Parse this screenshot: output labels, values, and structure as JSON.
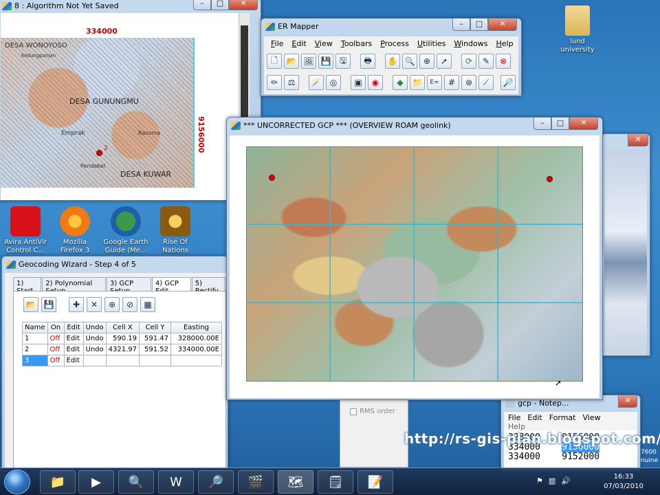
{
  "desktop": {
    "folder_label": "lund university",
    "icons": [
      {
        "label": "Avira AntiVir Control C...",
        "color": "#d8121a"
      },
      {
        "label": "Mozilla Firefox 3",
        "color": "#f07a16"
      },
      {
        "label": "Google Earth Guide (Me...",
        "color": "#2a8a3a"
      },
      {
        "label": "Rise Of Nations",
        "color": "#b8860b"
      }
    ],
    "watermark": "http://rs-gis-plan.blogspot.com/"
  },
  "algorithm_window": {
    "title": "8 : Algorithm Not Yet Saved",
    "easting_label": "334000",
    "northing_label": "9156000",
    "place_labels": [
      "DESA WONOYOSO",
      "DESA GUNUNGMU",
      "DESA KUWAR",
      "Emprak",
      "Rasoma",
      "Pendekel",
      "Kedungpanjan"
    ],
    "gcp_marker": "2"
  },
  "er_mapper": {
    "title": "ER Mapper",
    "menu": [
      "File",
      "Edit",
      "View",
      "Toolbars",
      "Process",
      "Utilities",
      "Windows",
      "Help"
    ],
    "toolbar1": [
      "new-file-icon",
      "open-folder-icon",
      "open-image-icon",
      "save-icon",
      "save-as-icon",
      "print-icon",
      "hand-icon",
      "zoom-icon",
      "zoom-box-icon",
      "pointer-icon",
      "refresh-icon",
      "edit-icon",
      "stop-icon"
    ],
    "toolbar2": [
      "pencil-icon",
      "balance-icon",
      "wizard-icon",
      "gps-icon",
      "image-process-icon",
      "filter-icon",
      "layers-icon",
      "folder-icon",
      "formula-icon",
      "grid-icon",
      "target-icon",
      "chart-icon",
      "search-icon"
    ]
  },
  "overview_window": {
    "title": "*** UNCORRECTED GCP *** (OVERVIEW ROAM geolink)"
  },
  "geocoding": {
    "title": "Geocoding Wizard - Step 4 of 5",
    "tabs": [
      "1) Start",
      "2) Polynomial Setup",
      "3) GCP Setup",
      "4) GCP Edit",
      "5) Rectify"
    ],
    "active_tab": 3,
    "columns": [
      "Name",
      "On",
      "Edit",
      "Undo",
      "Cell X",
      "Cell Y",
      "Easting"
    ],
    "rows": [
      [
        "1",
        "Off",
        "Edit",
        "Undo",
        "590.19",
        "591.47",
        "328000.00E"
      ],
      [
        "2",
        "Off",
        "Edit",
        "Undo",
        "4321.97",
        "591.52",
        "334000.00E"
      ],
      [
        "3",
        "Off",
        "Edit",
        "",
        "",
        "",
        ""
      ]
    ],
    "rms_order_label": "RMS order"
  },
  "notepad": {
    "title": "gcp - Notep...",
    "menu": [
      "File",
      "Edit",
      "Format",
      "View"
    ],
    "help_label": "Help",
    "lines": [
      {
        "easting": "328000",
        "northing": "9156000"
      },
      {
        "easting": "334000",
        "northing": "9156000"
      },
      {
        "easting": "334000",
        "northing": "9152000"
      }
    ]
  },
  "side_strip": {
    "text": "7600",
    "text2": "nuine"
  },
  "taskbar": {
    "start_icon": "windows-start-icon",
    "clock_time": "16:33",
    "clock_date": "07/03/2010"
  },
  "colors": {
    "marker": "#e00000",
    "grid_cyan": "#3fb3c9",
    "easting_label": "#cc0000"
  }
}
